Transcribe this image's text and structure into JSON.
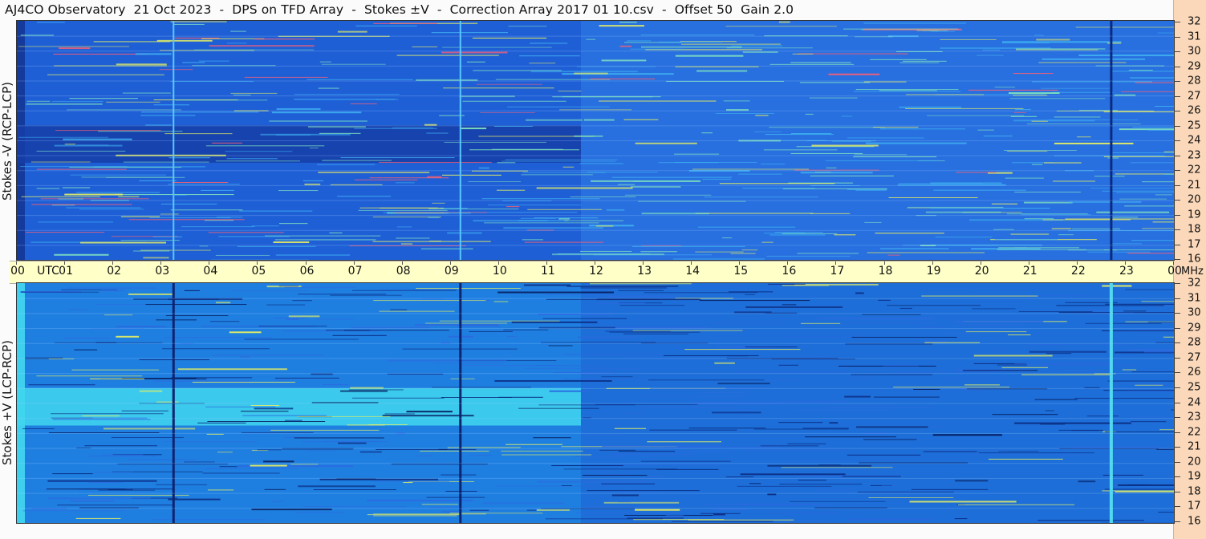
{
  "header": {
    "title": "AJ4CO Observatory  21 Oct 2023  -  DPS on TFD Array  -  Stokes ±V  -  Correction Array 2017 01 10.csv  -  Offset 50  Gain 2.0"
  },
  "panels": {
    "top": {
      "ylabel": "Stokes -V (RCP-LCP)"
    },
    "bottom": {
      "ylabel": "Stokes +V (LCP-RCP)"
    }
  },
  "time_axis": {
    "unit_label": "UTC",
    "labels": [
      "00",
      "01",
      "02",
      "03",
      "04",
      "05",
      "06",
      "07",
      "08",
      "09",
      "10",
      "11",
      "12",
      "13",
      "14",
      "15",
      "16",
      "17",
      "18",
      "19",
      "20",
      "21",
      "22",
      "23",
      "00"
    ]
  },
  "freq_axis": {
    "unit_label": "MHz",
    "labels": [
      "32",
      "31",
      "30",
      "29",
      "28",
      "27",
      "26",
      "25",
      "24",
      "23",
      "22",
      "21",
      "20",
      "19",
      "18",
      "17",
      "16"
    ]
  },
  "colors": {
    "top_background": "#1f5fd6",
    "top_dark_band": "#163ea8",
    "bottom_background": "#1f7fe0",
    "bottom_bright_band": "#41d6ee",
    "time_axis_bg": "#ffffc8",
    "freq_axis_bg": "#fbd8b9"
  },
  "chart_data": [
    {
      "type": "heatmap",
      "title": "Stokes -V (RCP-LCP)",
      "x": {
        "label": "UTC",
        "range": [
          0,
          24
        ],
        "ticks": [
          "00",
          "01",
          "02",
          "03",
          "04",
          "05",
          "06",
          "07",
          "08",
          "09",
          "10",
          "11",
          "12",
          "13",
          "14",
          "15",
          "16",
          "17",
          "18",
          "19",
          "20",
          "21",
          "22",
          "23",
          "00"
        ]
      },
      "y": {
        "label": "MHz",
        "range": [
          16,
          32
        ],
        "ticks": [
          16,
          17,
          18,
          19,
          20,
          21,
          22,
          23,
          24,
          25,
          26,
          27,
          28,
          29,
          30,
          31,
          32
        ]
      },
      "features": [
        {
          "kind": "vertical_line",
          "utc": 3.25
        },
        {
          "kind": "vertical_line",
          "utc": 9.2
        },
        {
          "kind": "dark_vertical_line",
          "utc": 22.7
        },
        {
          "kind": "dark_band",
          "utc_range": [
            0,
            11.7
          ],
          "mhz_range": [
            22.5,
            25
          ]
        }
      ]
    },
    {
      "type": "heatmap",
      "title": "Stokes +V (LCP-RCP)",
      "x": {
        "label": "UTC",
        "range": [
          0,
          24
        ],
        "ticks": [
          "00",
          "01",
          "02",
          "03",
          "04",
          "05",
          "06",
          "07",
          "08",
          "09",
          "10",
          "11",
          "12",
          "13",
          "14",
          "15",
          "16",
          "17",
          "18",
          "19",
          "20",
          "21",
          "22",
          "23",
          "00"
        ]
      },
      "y": {
        "label": "MHz",
        "range": [
          16,
          32
        ],
        "ticks": [
          16,
          17,
          18,
          19,
          20,
          21,
          22,
          23,
          24,
          25,
          26,
          27,
          28,
          29,
          30,
          31,
          32
        ]
      },
      "features": [
        {
          "kind": "dark_vertical_line",
          "utc": 3.25
        },
        {
          "kind": "dark_vertical_line",
          "utc": 9.2
        },
        {
          "kind": "bright_vertical_line",
          "utc": 22.7
        },
        {
          "kind": "bright_band",
          "utc_range": [
            0,
            11.7
          ],
          "mhz_range": [
            22.5,
            25
          ]
        }
      ]
    }
  ]
}
